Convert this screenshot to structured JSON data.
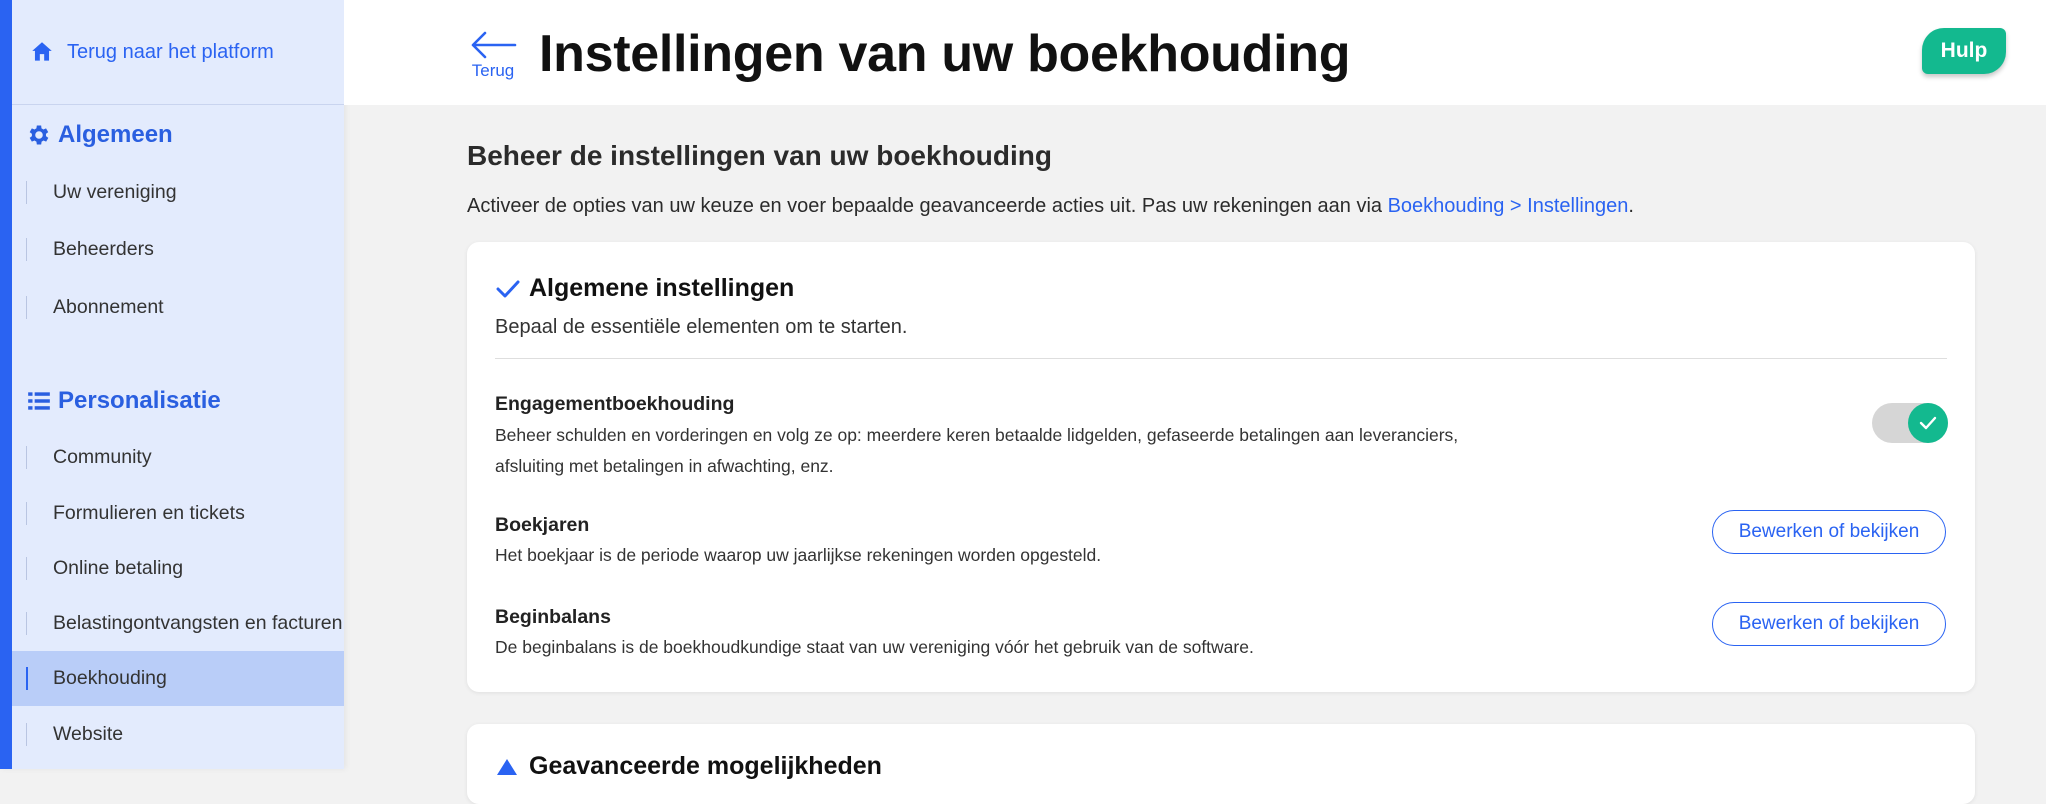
{
  "sidebar": {
    "back_link": "Terug naar het platform",
    "sections": [
      {
        "title": "Algemeen",
        "icon": "gear-icon"
      },
      {
        "title": "Personalisatie",
        "icon": "list-icon"
      }
    ],
    "general_items": [
      "Uw vereniging",
      "Beheerders",
      "Abonnement"
    ],
    "personalisation_items": [
      "Community",
      "Formulieren en tickets",
      "Online betaling",
      "Belastingontvangsten en facturen",
      "Boekhouding",
      "Website"
    ],
    "active_item": "Boekhouding"
  },
  "header": {
    "back_label": "Terug",
    "title": "Instellingen van uw boekhouding",
    "help_label": "Hulp"
  },
  "main": {
    "heading": "Beheer de instellingen van uw boekhouding",
    "description": "Activeer de opties van uw keuze en voer bepaalde geavanceerde acties uit. Pas uw rekeningen aan via ",
    "description_link": "Boekhouding > Instellingen",
    "description_end": "."
  },
  "general_card": {
    "title": "Algemene instellingen",
    "subtitle": "Bepaal de essentiële elementen om te starten.",
    "settings": [
      {
        "name": "Engagementboekhouding",
        "description": "Beheer schulden en vorderingen en volg ze op: meerdere keren betaalde lidgelden, gefaseerde betalingen aan leveranciers, afsluiting met betalingen in afwachting, enz.",
        "toggle_on": true
      },
      {
        "name": "Boekjaren",
        "description": "Het boekjaar is de periode waarop uw jaarlijkse rekeningen worden opgesteld.",
        "button": "Bewerken of bekijken"
      },
      {
        "name": "Beginbalans",
        "description": "De beginbalans is de boekhoudkundige staat van uw vereniging vóór het gebruik van de software.",
        "button": "Bewerken of bekijken"
      }
    ]
  },
  "advanced_card": {
    "title": "Geavanceerde mogelijkheden"
  },
  "colors": {
    "accent": "#2a63f2",
    "success": "#13b98f",
    "sidebar_bg": "#e3ebfd",
    "sidebar_active": "#b9cdf8"
  }
}
